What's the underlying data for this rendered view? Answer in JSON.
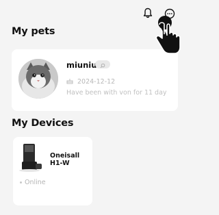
{
  "header": {
    "icons": [
      "bell-icon",
      "chat-bubble-icon"
    ]
  },
  "sections": {
    "pets_title": "My pets",
    "devices_title": "My Devices"
  },
  "pet": {
    "name": "miuniu",
    "badge_icon": "search-icon",
    "date": "2024-12-12",
    "since": "Have been with von for 11 day"
  },
  "device": {
    "name": "Oneisall H1-W",
    "status": "Online"
  },
  "cursor": "hand-pointer-icon"
}
